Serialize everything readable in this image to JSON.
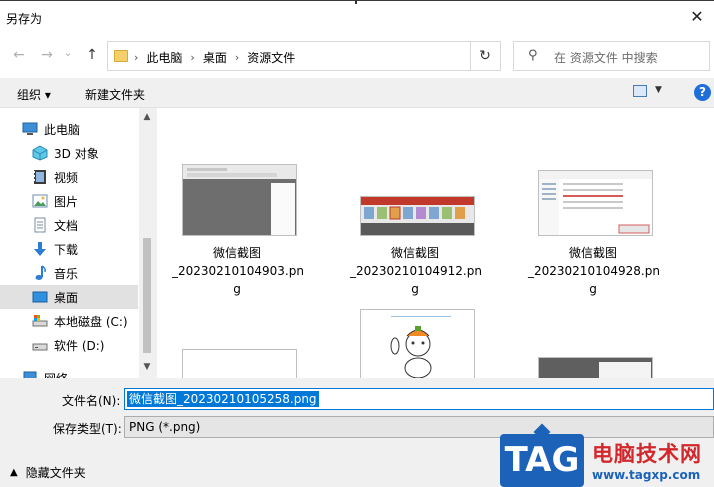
{
  "window": {
    "title": "另存为",
    "close_glyph": "✕"
  },
  "nav": {
    "back_glyph": "←",
    "forward_glyph": "→",
    "dropdown_glyph": "⌄",
    "up_glyph": "↑",
    "breadcrumb": [
      "此电脑",
      "桌面",
      "资源文件"
    ],
    "breadcrumb_sep": "›",
    "refresh_glyph": "↻",
    "search_placeholder": "在 资源文件 中搜索"
  },
  "toolbar": {
    "organize_label": "组织 ▾",
    "new_folder_label": "新建文件夹",
    "help_label": "?"
  },
  "sidebar": {
    "items": [
      {
        "label": "此电脑",
        "icon": "computer-icon"
      },
      {
        "label": "3D 对象",
        "icon": "3d-objects-icon"
      },
      {
        "label": "视频",
        "icon": "video-icon"
      },
      {
        "label": "图片",
        "icon": "pictures-icon"
      },
      {
        "label": "文档",
        "icon": "documents-icon"
      },
      {
        "label": "下载",
        "icon": "download-icon"
      },
      {
        "label": "音乐",
        "icon": "music-icon"
      },
      {
        "label": "桌面",
        "icon": "desktop-icon",
        "selected": true
      },
      {
        "label": "本地磁盘 (C:)",
        "icon": "drive-c-icon"
      },
      {
        "label": "软件 (D:)",
        "icon": "drive-d-icon"
      },
      {
        "label": "网络",
        "icon": "network-icon"
      }
    ]
  },
  "files": [
    {
      "line1": "微信截图",
      "line2": "_20230210104903.pn",
      "line3": "g"
    },
    {
      "line1": "微信截图",
      "line2": "_20230210104912.pn",
      "line3": "g"
    },
    {
      "line1": "微信截图",
      "line2": "_20230210104928.pn",
      "line3": "g"
    }
  ],
  "form": {
    "filename_label": "文件名(N):",
    "filename_value": "微信截图_20230210105258.png",
    "filetype_label": "保存类型(T):",
    "filetype_value": "PNG (*.png)",
    "hide_folders_label": "隐藏文件夹"
  },
  "watermark": {
    "tag": "TAG",
    "title": "电脑技术网",
    "url": "www.tagxp.com"
  },
  "colors": {
    "accent": "#0078d7",
    "selected_bg": "#e1e1e1",
    "watermark_blue": "#1b62b8",
    "watermark_red": "#d2282c"
  }
}
